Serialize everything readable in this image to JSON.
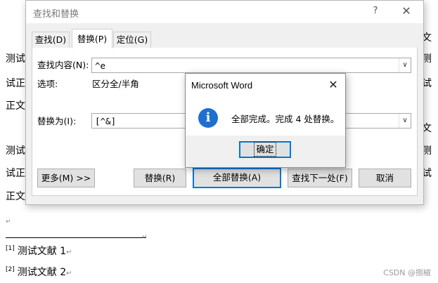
{
  "document": {
    "right_edge_lines": [
      "文",
      "测",
      "试",
      "文",
      "测",
      "试"
    ],
    "left_edge_lines": [
      "测试",
      "试正",
      "正文",
      "测试",
      "试正",
      "正文"
    ],
    "paragraph_mark": "↵",
    "footnotes": [
      {
        "ref": "[1]",
        "text": "测试文献 1"
      },
      {
        "ref": "[2]",
        "text": "测试文献 2"
      }
    ],
    "watermark": "CSDN @捌椒"
  },
  "find_replace": {
    "title": "查找和替换",
    "help": "?",
    "close": "✕",
    "tabs": [
      "查找(D)",
      "替换(P)",
      "定位(G)"
    ],
    "find_label": "查找内容(N):",
    "find_value": "^e",
    "options_label": "选项:",
    "options_value": "区分全/半角",
    "replace_label": "替换为(I):",
    "replace_value": "[^&]",
    "dropdown_arrow": "∨",
    "buttons": {
      "more": "更多(M) >>",
      "replace": "替换(R)",
      "replace_all": "全部替换(A)",
      "find_next": "查找下一处(F)",
      "cancel": "取消"
    }
  },
  "message_box": {
    "title": "Microsoft Word",
    "close": "✕",
    "icon": "i",
    "text": "全部完成。完成 4 处替换。",
    "ok": "确定"
  },
  "colors": {
    "accent": "#0078d7",
    "info_icon": "#1e6fd0",
    "dialog_bg": "#f0f0f0",
    "button_bg": "#e1e1e1"
  }
}
